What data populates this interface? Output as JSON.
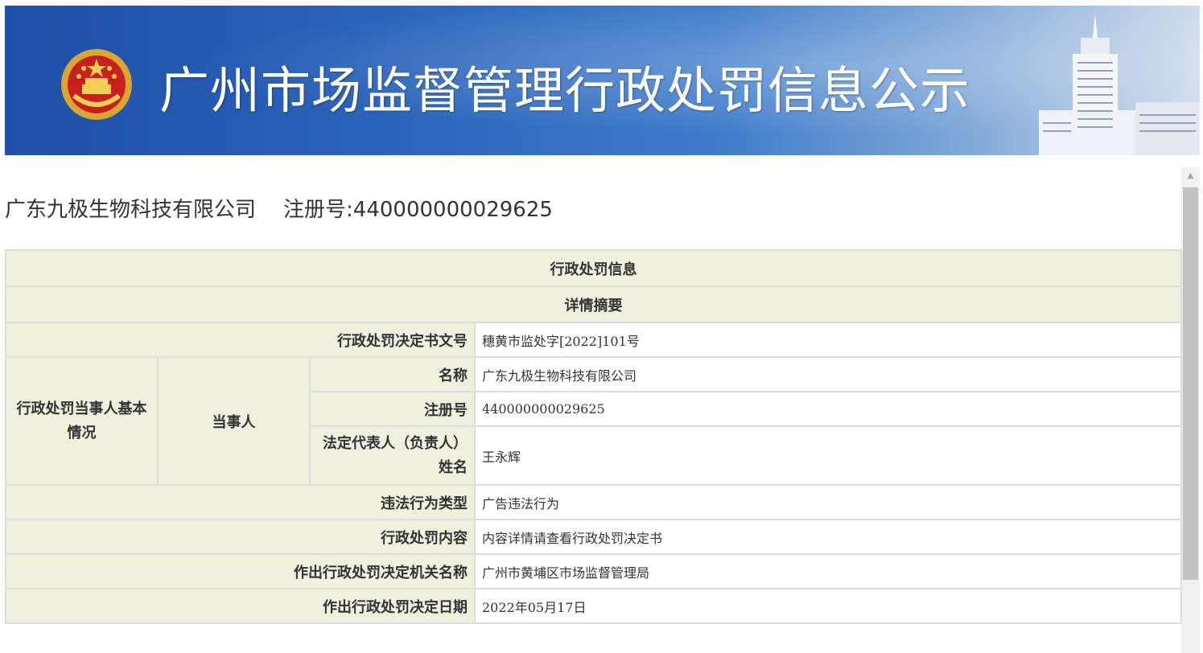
{
  "banner": {
    "title": "广州市场监督管理行政处罚信息公示",
    "emblem_icon": "national-emblem-icon",
    "building_icon": "government-building-icon",
    "colors": {
      "banner_dark": "#1f4fa6",
      "banner_light": "#cfdcec"
    }
  },
  "company": {
    "name": "广东九极生物科技有限公司",
    "reg_label": "注册号:",
    "reg_no": "440000000029625"
  },
  "table": {
    "section_title": "行政处罚信息",
    "summary_title": "详情摘要",
    "doc_no_label": "行政处罚决定书文号",
    "doc_no_value": "穗黄市监处字[2022]101号",
    "party_group_label": "行政处罚当事人基本情况",
    "party_label": "当事人",
    "name_label": "名称",
    "name_value": "广东九极生物科技有限公司",
    "reg_label": "注册号",
    "reg_value": "440000000029625",
    "legal_rep_label": "法定代表人（负责人）姓名",
    "legal_rep_value": "王永辉",
    "violation_type_label": "违法行为类型",
    "violation_type_value": "广告违法行为",
    "penalty_content_label": "行政处罚内容",
    "penalty_content_value": "内容详情请查看行政处罚决定书",
    "authority_label": "作出行政处罚决定机关名称",
    "authority_value": "广州市黄埔区市场监督管理局",
    "date_label": "作出行政处罚决定日期",
    "date_value": "2022年05月17日"
  },
  "colors": {
    "label_bg": "#f0f0de",
    "border": "#dcdcdc",
    "text": "#333333"
  }
}
